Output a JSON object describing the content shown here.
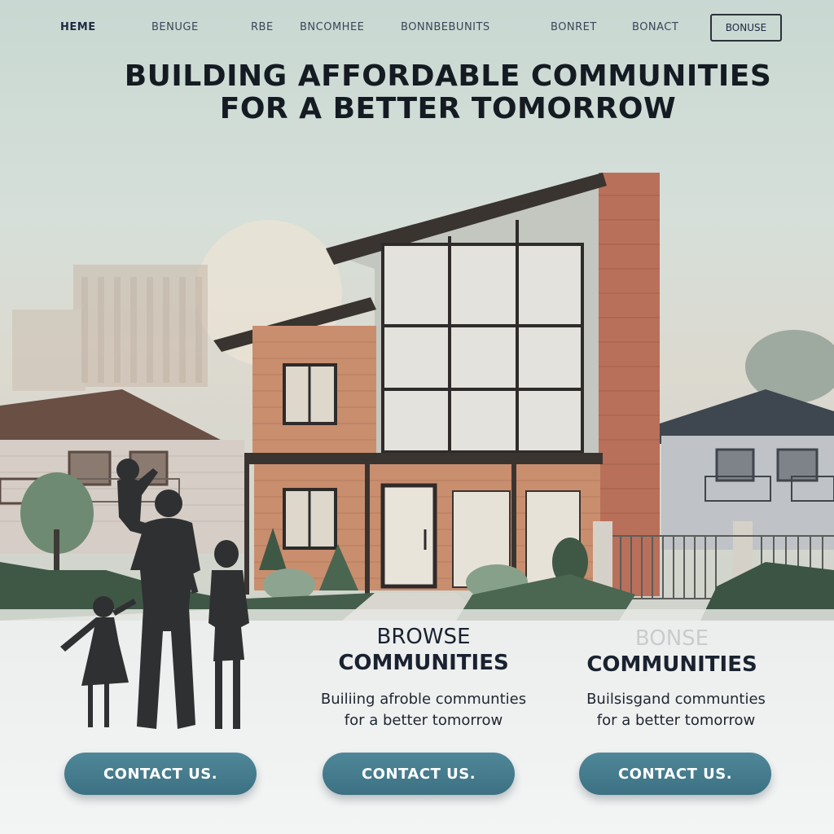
{
  "nav": {
    "links": [
      "HEME",
      "BENUGE",
      "RBE",
      "BNCOMHEE",
      "BONNBEBUNITS",
      "BONRET",
      "BONACT"
    ],
    "button_label": "BONUSE"
  },
  "hero": {
    "title_line1": "BUILDING AFFORDABLE COMMUNITIES",
    "title_line2": "FOR A BETTER TOMORROW"
  },
  "cards": [
    {
      "heading_line1": "",
      "heading_line2": "",
      "text_line1": "",
      "text_line2": "",
      "cta_label": "CONTACT US."
    },
    {
      "heading_line1": "BROWSE",
      "heading_line2": "COMMUNITIES",
      "text_line1": "Builiing afroble communties",
      "text_line2": "for a better tomorrow",
      "cta_label": "CONTACT US."
    },
    {
      "heading_line1": "BONSE",
      "heading_line2": "COMMUNITIES",
      "text_line1": "Builsisgand communties",
      "text_line2": "for a better tomorrow",
      "cta_label": "CONTACT US."
    }
  ],
  "colors": {
    "accent": "#3f7a8c",
    "title": "#151b22",
    "brick": "#b56f58",
    "siding": "#c58f72"
  }
}
